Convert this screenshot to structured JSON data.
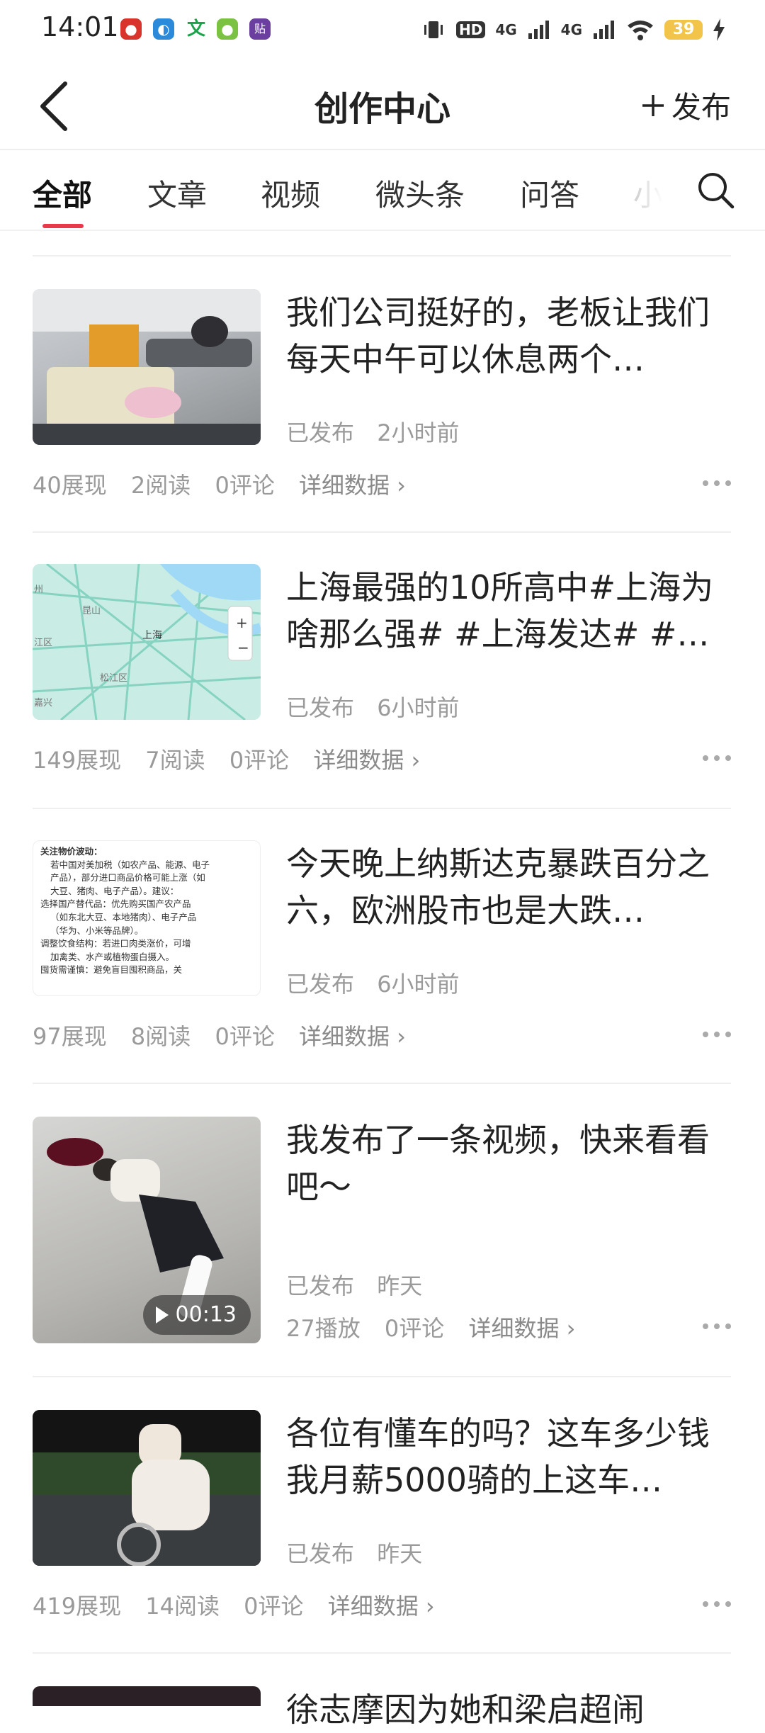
{
  "status_bar": {
    "time": "14:01",
    "network1": "4G",
    "network2": "4G",
    "hd": "HD",
    "battery": "39",
    "notification_icons": [
      "app-icon-red",
      "app-icon-browser",
      "app-icon-text",
      "app-icon-green",
      "app-icon-purple"
    ]
  },
  "header": {
    "title": "创作中心",
    "publish_label": "发布"
  },
  "tabs": [
    "全部",
    "文章",
    "视频",
    "微头条",
    "问答",
    "小"
  ],
  "articles": [
    {
      "title": "我们公司挺好的，老板让我们每天中午可以休息两个…",
      "status": "已发布",
      "time": "2小时前",
      "stats": [
        "40展现",
        "2阅读",
        "0评论"
      ],
      "detail": "详细数据 ›",
      "thumb": "office-nap-photo"
    },
    {
      "title": "上海最强的10所高中#上海为啥那么强# #上海发达# #…",
      "status": "已发布",
      "time": "6小时前",
      "stats": [
        "149展现",
        "7阅读",
        "0评论"
      ],
      "detail": "详细数据 ›",
      "thumb": "shanghai-map",
      "map_labels": [
        "昆山",
        "上海",
        "松江区",
        "嘉兴",
        "州",
        "江区"
      ]
    },
    {
      "title": "今天晚上纳斯达克暴跌百分之六，欧洲股市也是大跌…",
      "status": "已发布",
      "time": "6小时前",
      "stats": [
        "97展现",
        "8阅读",
        "0评论"
      ],
      "detail": "详细数据 ›",
      "thumb": "text-document",
      "doc_lines": [
        "关注物价波动：",
        "若中国对美加税（如农产品、能源、电子",
        "产品），部分进口商品价格可能上涨（如",
        "大豆、猪肉、电子产品）。建议：",
        "选择国产替代品：优先购买国产农产品",
        "（如东北大豆、本地猪肉）、电子产品",
        "（华为、小米等品牌）。",
        "调整饮食结构：若进口肉类涨价，可增",
        "加禽类、水产或植物蛋白摄入。",
        "囤货需谨慎：避免盲目囤积商品，关"
      ]
    },
    {
      "title": "我发布了一条视频，快来看看吧～",
      "status": "已发布",
      "time": "昨天",
      "stats": [
        "27播放",
        "0评论"
      ],
      "detail": "详细数据 ›",
      "thumb": "video-frame",
      "duration": "00:13"
    },
    {
      "title": "各位有懂车的吗？这车多少钱我月薪5000骑的上这车…",
      "status": "已发布",
      "time": "昨天",
      "stats": [
        "419展现",
        "14阅读",
        "0评论"
      ],
      "detail": "详细数据 ›",
      "thumb": "night-bike-photo"
    },
    {
      "title": "徐志摩因为她和梁启超闹",
      "thumb": "dark-photo"
    }
  ],
  "colors": {
    "accent": "#e8394a",
    "text": "#222222",
    "secondary": "#9a9a9a"
  }
}
